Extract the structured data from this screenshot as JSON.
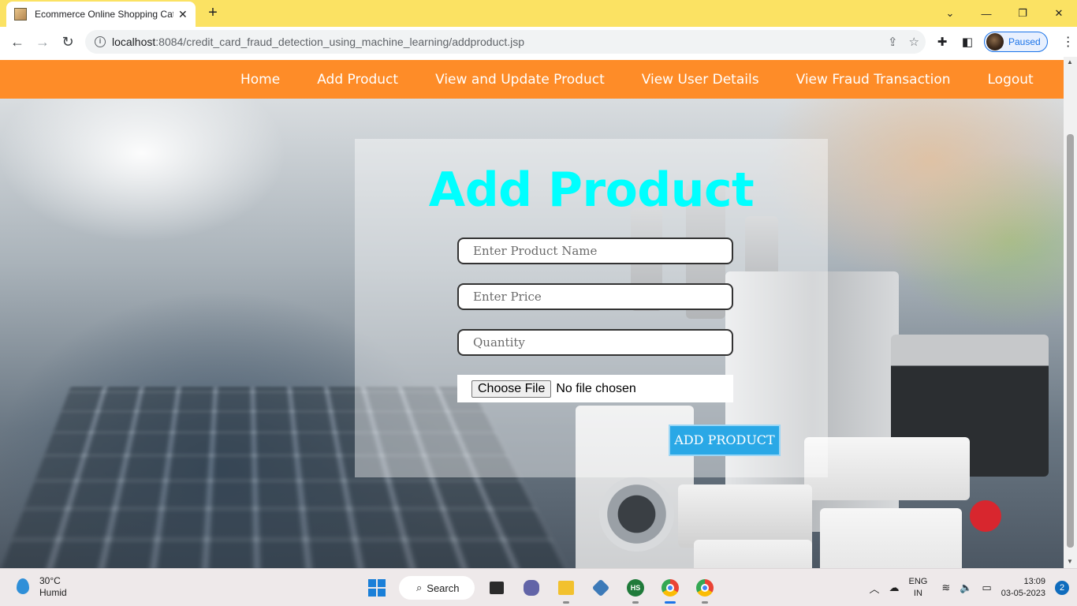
{
  "browser": {
    "tab_title": "Ecommerce Online Shopping Cat",
    "url_host": "localhost",
    "url_path": ":8084/credit_card_fraud_detection_using_machine_learning/addproduct.jsp",
    "profile_status": "Paused"
  },
  "nav": {
    "items": [
      {
        "label": "Home"
      },
      {
        "label": "Add Product"
      },
      {
        "label": "View and Update Product"
      },
      {
        "label": "View User Details"
      },
      {
        "label": "View Fraud Transaction"
      },
      {
        "label": "Logout"
      }
    ]
  },
  "form": {
    "title": "Add Product",
    "product_name_placeholder": "Enter Product Name",
    "price_placeholder": "Enter Price",
    "quantity_placeholder": "Quantity",
    "file_button_label": "Choose File",
    "file_status": "No file chosen",
    "submit_label": "ADD PRODUCT"
  },
  "taskbar": {
    "temperature": "30°C",
    "weather_condition": "Humid",
    "search_label": "Search",
    "hs_label": "HS",
    "language_line1": "ENG",
    "language_line2": "IN",
    "time": "13:09",
    "date": "03-05-2023",
    "notification_count": "2"
  },
  "colors": {
    "nav_background": "#fe8c28",
    "title_color": "#00ffff",
    "submit_background": "#2aa8e6",
    "browser_frame": "#fbe263"
  }
}
